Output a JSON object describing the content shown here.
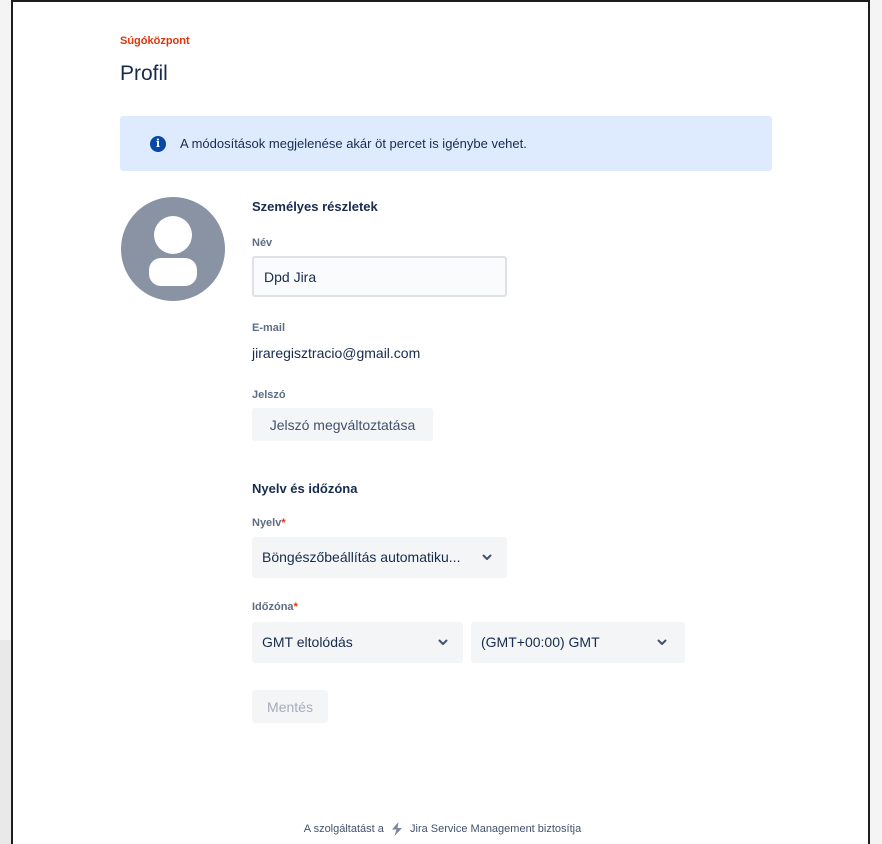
{
  "breadcrumb": {
    "label": "Súgóközpont"
  },
  "page": {
    "title": "Profil"
  },
  "banner": {
    "message": "A módosítások megjelenése akár öt percet is igénybe vehet.",
    "icon": "info-icon"
  },
  "personal": {
    "heading": "Személyes részletek",
    "name_label": "Név",
    "name_value": "Dpd Jira",
    "email_label": "E-mail",
    "email_value": "jiraregisztracio@gmail.com",
    "password_label": "Jelszó",
    "change_password_label": "Jelszó megváltoztatása"
  },
  "lang_tz": {
    "heading": "Nyelv és időzóna",
    "language_label": "Nyelv",
    "language_value": "Böngészőbeállítás automatiku...",
    "timezone_label": "Időzóna",
    "timezone_mode_value": "GMT eltolódás",
    "timezone_value": "(GMT+00:00) GMT",
    "required_mark": "*"
  },
  "actions": {
    "save_label": "Mentés"
  },
  "footer": {
    "prefix": "A szolgáltatást a",
    "product": "Jira Service Management biztosítja",
    "logo_icon": "jira-service-management-logo"
  },
  "colors": {
    "accent_red": "#de350b",
    "banner_bg": "#deebff",
    "info_icon": "#0747a6",
    "avatar": "#8993a4",
    "text": "#172b4d"
  }
}
